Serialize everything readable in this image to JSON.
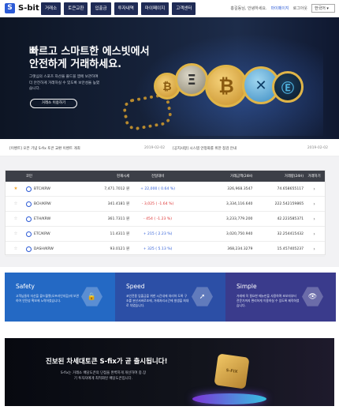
{
  "header": {
    "logo_text": "S-bit",
    "nav": [
      "거래소",
      "토큰교환",
      "입출금",
      "투자내역",
      "마이페이지",
      "고객센터"
    ],
    "top_links": [
      "홍길동님, 안녕하세요.",
      "마이페이지",
      "로그아웃"
    ],
    "language": "한국어"
  },
  "hero": {
    "title": "빠르고 스마트한 에스빗에서 안전하게 거래하세요.",
    "description": "그랫심의 스포츠 자산을 플드블 앰에 보관하여 더 안전하게 거래하실 수 있도록 보안성을 높였습니다.",
    "button": "거래소 이용하기",
    "coins": [
      "₿",
      "Ξ",
      "₿",
      "✕",
      "Ⓔ"
    ]
  },
  "ticker": {
    "notice1": "[이벤트] 오픈 기념 S-fix 토큰 교환 이벤트 개최",
    "date1": "2019-02-02",
    "notice2": "[공지사항] 시스템 안정화를 위한 점검 안내",
    "date2": "2019-02-02"
  },
  "market": {
    "headers": [
      "",
      "코인",
      "현재시세",
      "전일대비",
      "거래금액(24H)",
      "거래량(24H)",
      "거래하기"
    ],
    "rows": [
      {
        "star": "★",
        "coin": "BTC/KRW",
        "price": "7,471.7012 원",
        "change": "+ 22,000 ( 0.64 %)",
        "dir": "up",
        "amount": "326,968.3547",
        "volume": "74.658655117"
      },
      {
        "star": "☆",
        "coin": "BCH/KRW",
        "price": "341.4181 원",
        "change": "- 3,025 ( -1.64 %)",
        "dir": "down",
        "amount": "3,334,116.640",
        "volume": "222.542159865"
      },
      {
        "star": "☆",
        "coin": "ETH/KRW",
        "price": "361.7311 원",
        "change": "- 454 ( -1.23 %)",
        "dir": "down",
        "amount": "3,233,779.200",
        "volume": "42.223585371"
      },
      {
        "star": "☆",
        "coin": "ETC/KRW",
        "price": "11.4311 원",
        "change": "+ 215 ( 2.23 %)",
        "dir": "up",
        "amount": "3,020,750.940",
        "volume": "32.254415432"
      },
      {
        "star": "☆",
        "coin": "DASH/KRW",
        "price": "93.0121 원",
        "change": "+ 325 ( 5.13 %)",
        "dir": "up",
        "amount": "368,234.3279",
        "volume": "15.457405237"
      }
    ]
  },
  "features": [
    {
      "title": "Safety",
      "text": "고객님들의 자산을 콜드월렛(오프라인지갑)에 보관하여 안전성 확보에 노력하였습니다.",
      "color": "#2469c4",
      "icon": "🔒"
    },
    {
      "title": "Speed",
      "text": "코인전용 입출금을 위한 시간내에 처리하 도록 구조를 분산서버로조에, 거래처리시간에 발생을 최대로 차였습니다.",
      "color": "#2c4fa6",
      "icon": "➚"
    },
    {
      "title": "Simple",
      "text": "거래에 꼭 필요한 메뉴만을 사용하며 초보자부터 전문가까지 편리하게 이용하실 수 있도록 제작하였습니다.",
      "color": "#3a3b8c",
      "icon": "👁"
    }
  ],
  "banner": {
    "title": "진보된 차세대토큰 S-fix가 곧 출시됩니다!",
    "text": "S-fix는 거래소 배당도큰의 단점을 완벽하게 개선하여 중.장기 투자자에게 최적화된 배당도큰입니다.",
    "coin_label": "S-FIX"
  }
}
